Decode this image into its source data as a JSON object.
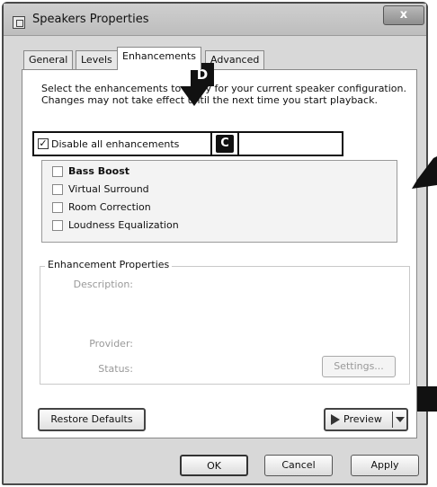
{
  "window": {
    "title": "Speakers Properties",
    "close_label": "x"
  },
  "tabs": [
    {
      "label": "General"
    },
    {
      "label": "Levels"
    },
    {
      "label": "Enhancements"
    },
    {
      "label": "Advanced"
    }
  ],
  "intro_text": "Select the enhancements to apply for your current speaker configuration. Changes may not take effect until the next time you start playback.",
  "disable_all": {
    "label": "Disable all enhancements",
    "checked_mark": "✓"
  },
  "enhancements": [
    {
      "label": "Bass Boost"
    },
    {
      "label": "Virtual Surround"
    },
    {
      "label": "Room Correction"
    },
    {
      "label": "Loudness Equalization"
    }
  ],
  "properties": {
    "title": "Enhancement Properties",
    "description_label": "Description:",
    "provider_label": "Provider:",
    "status_label": "Status:",
    "settings_label": "Settings..."
  },
  "buttons": {
    "restore_defaults": "Restore Defaults",
    "preview": "Preview",
    "ok": "OK",
    "cancel": "Cancel",
    "apply": "Apply"
  },
  "annotations": {
    "d": "D",
    "c": "C"
  }
}
